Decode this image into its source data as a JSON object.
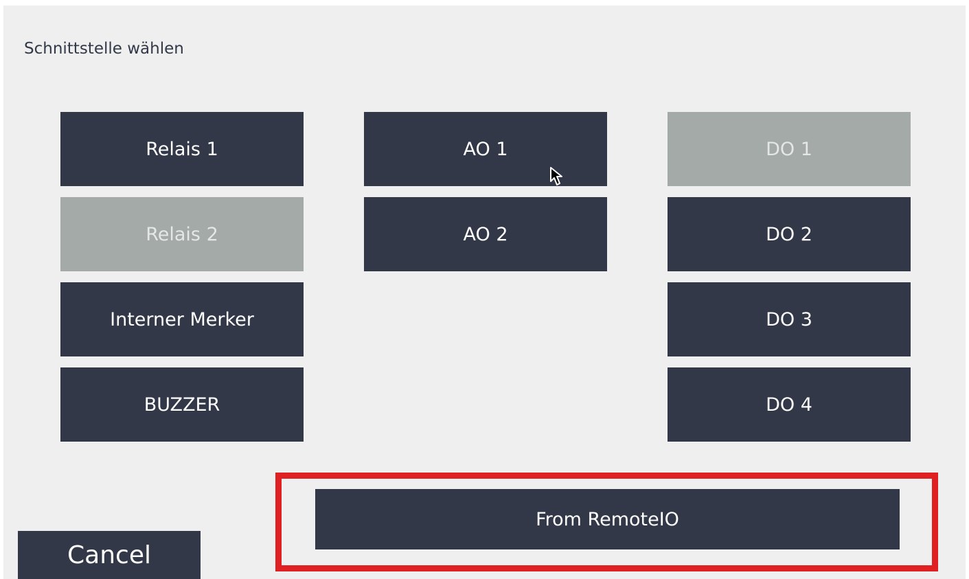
{
  "dialog": {
    "title": "Schnittstelle wählen"
  },
  "outputs": {
    "relais_1": {
      "label": "Relais 1",
      "enabled": true
    },
    "relais_2": {
      "label": "Relais 2",
      "enabled": false
    },
    "interner_merker": {
      "label": "Interner Merker",
      "enabled": true
    },
    "buzzer": {
      "label": "BUZZER",
      "enabled": true
    },
    "ao_1": {
      "label": "AO 1",
      "enabled": true
    },
    "ao_2": {
      "label": "AO 2",
      "enabled": true
    },
    "do_1": {
      "label": "DO 1",
      "enabled": false
    },
    "do_2": {
      "label": "DO 2",
      "enabled": true
    },
    "do_3": {
      "label": "DO 3",
      "enabled": true
    },
    "do_4": {
      "label": "DO 4",
      "enabled": true
    }
  },
  "actions": {
    "remote_io_label": "From RemoteIO",
    "cancel_label": "Cancel"
  },
  "colors": {
    "button_bg": "#323848",
    "button_disabled_bg": "#a4aaa8",
    "panel_bg": "#efefef",
    "highlight": "#e02123"
  }
}
